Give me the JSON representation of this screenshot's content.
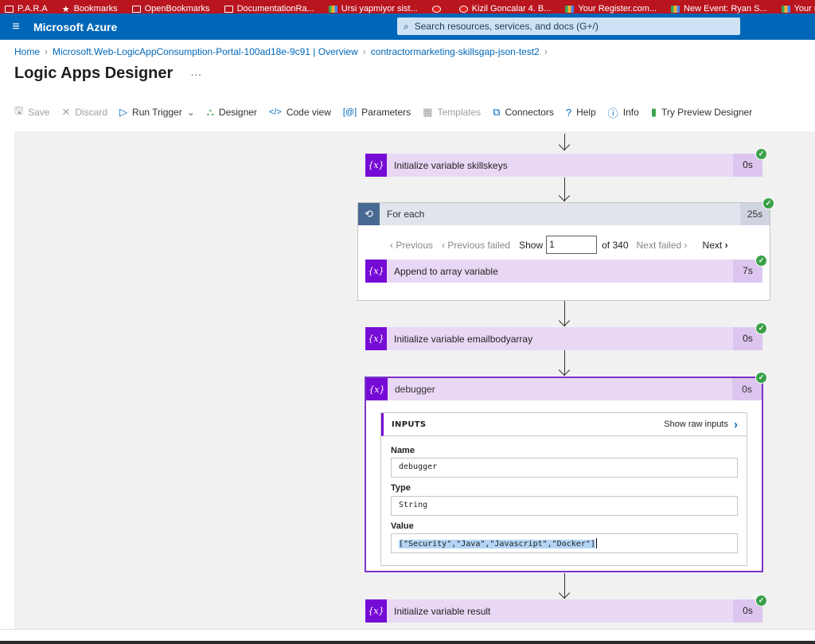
{
  "bookmarks": [
    {
      "label": "P.A.R.A",
      "icon": "folder-icon"
    },
    {
      "label": "Bookmarks",
      "icon": "star-icon"
    },
    {
      "label": "OpenBookmarks",
      "icon": "folder-icon"
    },
    {
      "label": "DocumentationRa...",
      "icon": "folder-icon"
    },
    {
      "label": "Ursi yapmiyor sist...",
      "icon": "app-icon"
    },
    {
      "label": "",
      "icon": "red-circle-icon"
    },
    {
      "label": "Kizil Goncalar 4. B...",
      "icon": "red-circle-icon"
    },
    {
      "label": "Your Register.com...",
      "icon": "app-icon"
    },
    {
      "label": "New Event: Ryan S...",
      "icon": "app-icon"
    },
    {
      "label": "Your renewal ac",
      "icon": "app-icon"
    }
  ],
  "header": {
    "brand": "Microsoft Azure",
    "search_placeholder": "Search resources, services, and docs (G+/)"
  },
  "breadcrumb": {
    "home": "Home",
    "item1": "Microsoft.Web-LogicAppConsumption-Portal-100ad18e-9c91 | Overview",
    "item2": "contractormarketing-skillsgap-json-test2"
  },
  "page_title": "Logic Apps Designer",
  "toolbar": {
    "save": "Save",
    "discard": "Discard",
    "run_trigger": "Run Trigger",
    "designer": "Designer",
    "code_view": "Code view",
    "parameters": "Parameters",
    "templates": "Templates",
    "connectors": "Connectors",
    "help": "Help",
    "info": "Info",
    "try_preview": "Try Preview Designer"
  },
  "steps": {
    "init_skillskeys": {
      "title": "Initialize variable skillskeys",
      "duration": "0s"
    },
    "for_each": {
      "title": "For each",
      "duration": "25s",
      "pager": {
        "previous": "Previous",
        "previous_failed": "Previous failed",
        "show": "Show",
        "current": "1",
        "of_total": "of 340",
        "next_failed": "Next failed",
        "next": "Next"
      },
      "inner": {
        "title": "Append to array variable",
        "duration": "7s"
      }
    },
    "init_emailbodyarray": {
      "title": "Initialize variable emailbodyarray",
      "duration": "0s"
    },
    "debugger": {
      "title": "debugger",
      "duration": "0s",
      "inputs_label": "INPUTS",
      "show_raw": "Show raw inputs",
      "name_label": "Name",
      "name_value": "debugger",
      "type_label": "Type",
      "type_value": "String",
      "value_label": "Value",
      "value_value": "[\"Security\",\"Java\",\"Javascript\",\"Docker\"]"
    },
    "init_result": {
      "title": "Initialize variable result",
      "duration": "0s"
    }
  },
  "colors": {
    "azure_blue": "#0067b8",
    "variable_purple": "#770bd6",
    "success_green": "#3aa14a"
  }
}
